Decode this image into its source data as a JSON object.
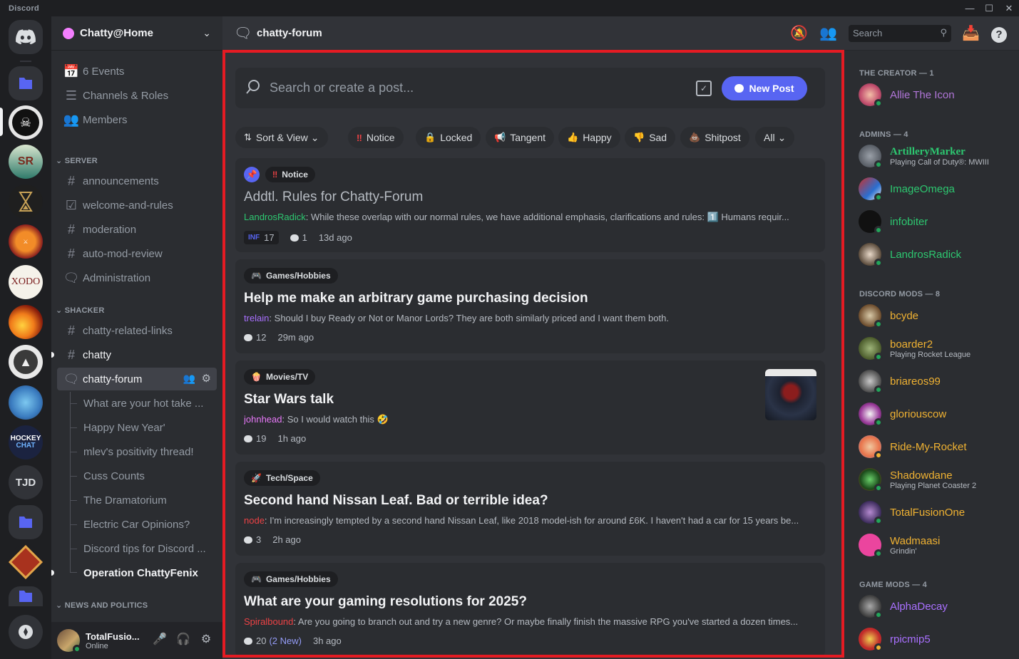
{
  "app": {
    "title": "Discord"
  },
  "colors": {
    "accent": "#5865f2",
    "highlight_frame": "#e51b23",
    "online": "#23a55a"
  },
  "rail": {
    "servers": [
      {
        "name": "home",
        "icon": "discord-logo-icon"
      },
      {
        "name": "folder-1",
        "icon": "folder-icon"
      },
      {
        "name": "server-raiders",
        "icon": "server-avatar"
      },
      {
        "name": "server-sr",
        "label": "SR"
      },
      {
        "name": "server-hourglass",
        "icon": "hourglass-icon"
      },
      {
        "name": "server-paladin",
        "icon": "server-avatar"
      },
      {
        "name": "server-xodo",
        "icon": "server-avatar"
      },
      {
        "name": "server-fenix",
        "icon": "fire-icon"
      },
      {
        "name": "server-wolf",
        "icon": "wolf-icon"
      },
      {
        "name": "server-stitch",
        "icon": "server-avatar"
      },
      {
        "name": "server-hockey",
        "label": "HOCKEY CHAT"
      },
      {
        "name": "server-tjd",
        "label": "TJD"
      },
      {
        "name": "folder-2",
        "icon": "folder-icon"
      },
      {
        "name": "server-diamond",
        "icon": "server-avatar"
      },
      {
        "name": "folder-3",
        "icon": "folder-icon"
      },
      {
        "name": "discover",
        "icon": "compass-icon"
      }
    ]
  },
  "sidebar": {
    "guild_name": "Chatty@Home",
    "top_items": [
      {
        "label": "6 Events",
        "icon": "calendar-icon"
      },
      {
        "label": "Channels & Roles",
        "icon": "list-icon"
      },
      {
        "label": "Members",
        "icon": "members-icon"
      }
    ],
    "categories": {
      "server": "SERVER",
      "shacker": "SHACKER",
      "news": "NEWS AND POLITICS"
    },
    "server_channels": [
      {
        "label": "announcements",
        "icon": "hash-icon"
      },
      {
        "label": "welcome-and-rules",
        "icon": "rules-icon"
      },
      {
        "label": "moderation",
        "icon": "hash-lock-icon"
      },
      {
        "label": "auto-mod-review",
        "icon": "hash-lock-icon"
      },
      {
        "label": "Administration",
        "icon": "forum-lock-icon"
      }
    ],
    "shacker_channels": [
      {
        "label": "chatty-related-links",
        "icon": "hash-icon"
      },
      {
        "label": "chatty",
        "icon": "hash-icon"
      },
      {
        "label": "chatty-forum",
        "icon": "forum-icon"
      }
    ],
    "threads": [
      {
        "label": "What are your hot take ..."
      },
      {
        "label": "Happy New Year'"
      },
      {
        "label": "mlev's positivity thread!"
      },
      {
        "label": "Cuss Counts"
      },
      {
        "label": "The Dramatorium"
      },
      {
        "label": "Electric Car Opinions?"
      },
      {
        "label": "Discord tips for Discord ..."
      },
      {
        "label": "Operation ChattyFenix"
      }
    ],
    "user": {
      "name": "TotalFusio...",
      "status": "Online"
    }
  },
  "header": {
    "channel": "chatty-forum",
    "search_placeholder": "Search"
  },
  "forum": {
    "search_placeholder": "Search or create a post...",
    "new_post_label": "New Post",
    "filters": [
      {
        "label": "Sort & View",
        "icon": "sort-icon"
      },
      {
        "label": "Notice",
        "icon": "‼"
      },
      {
        "label": "Locked",
        "icon": "🔒"
      },
      {
        "label": "Tangent",
        "icon": "📢"
      },
      {
        "label": "Happy",
        "icon": "👍"
      },
      {
        "label": "Sad",
        "icon": "👎"
      },
      {
        "label": "Shitpost",
        "icon": "💩"
      },
      {
        "label": "All",
        "icon": ""
      }
    ],
    "posts": [
      {
        "tag": "Notice",
        "title": "Addtl. Rules for Chatty-Forum",
        "author": "LandrosRadick",
        "author_color": "#2dc770",
        "snippet": "While these overlap with our normal rules, we have additional emphasis, clarifications and rules: 1️⃣ Humans requir...",
        "reaction_label": "INF",
        "reaction_count": "17",
        "replies": "1",
        "time": "13d ago"
      },
      {
        "tag": "Games/Hobbies",
        "title": "Help me make an arbitrary game purchasing decision",
        "author": "trelain",
        "author_color": "#a970ff",
        "snippet": "Should I buy Ready or Not or Manor Lords? They are both similarly priced and I want them both.",
        "replies": "12",
        "time": "29m ago"
      },
      {
        "tag": "Movies/TV",
        "title": "Star Wars talk",
        "author": "johnhead",
        "author_color": "#e879f9",
        "snippet": "So I would watch this 🤣",
        "replies": "19",
        "time": "1h ago"
      },
      {
        "tag": "Tech/Space",
        "title": "Second hand Nissan Leaf. Bad or terrible idea?",
        "author": "node",
        "author_color": "#ed4245",
        "snippet": "I'm increasingly tempted by a second hand Nissan Leaf, like 2018 model-ish for around £6K. I haven't had a car for 15 years be...",
        "replies": "3",
        "time": "2h ago"
      },
      {
        "tag": "Games/Hobbies",
        "title": "What are your gaming resolutions for 2025?",
        "author": "Spiralbound",
        "author_color": "#ed4245",
        "snippet": "Are you going to branch out and try a new genre? Or maybe finally finish the massive RPG you've started a dozen times...",
        "replies": "20",
        "replies_new": "(2 New)",
        "time": "3h ago"
      }
    ]
  },
  "members": {
    "groups": [
      {
        "title": "THE CREATOR — 1"
      },
      {
        "title": "ADMINS — 4"
      },
      {
        "title": "DISCORD MODS — 8"
      },
      {
        "title": "GAME MODS — 4"
      }
    ],
    "list": [
      {
        "name": "Allie The Icon",
        "color": "#b176d9",
        "activity": ""
      },
      {
        "name": "ArtilleryMarker",
        "color": "#2dc770",
        "activity": "Playing Call of Duty®: MWIII"
      },
      {
        "name": "ImageOmega",
        "color": "#2dc770",
        "activity": ""
      },
      {
        "name": "infobiter",
        "color": "#2dc770",
        "activity": ""
      },
      {
        "name": "LandrosRadick",
        "color": "#2dc770",
        "activity": ""
      },
      {
        "name": "bcyde",
        "color": "#f0b232",
        "activity": ""
      },
      {
        "name": "boarder2",
        "color": "#f0b232",
        "activity": "Playing Rocket League"
      },
      {
        "name": "briareos99",
        "color": "#f0b232",
        "activity": ""
      },
      {
        "name": "gloriouscow",
        "color": "#f0b232",
        "activity": ""
      },
      {
        "name": "Ride-My-Rocket",
        "color": "#f0b232",
        "activity": ""
      },
      {
        "name": "Shadowdane",
        "color": "#f0b232",
        "activity": "Playing Planet Coaster 2"
      },
      {
        "name": "TotalFusionOne",
        "color": "#f0b232",
        "activity": ""
      },
      {
        "name": "Wadmaasi",
        "color": "#f0b232",
        "activity": "Grindin'"
      },
      {
        "name": "AlphaDecay",
        "color": "#a970ff",
        "activity": ""
      },
      {
        "name": "rpicmip5",
        "color": "#a970ff",
        "activity": ""
      }
    ]
  }
}
